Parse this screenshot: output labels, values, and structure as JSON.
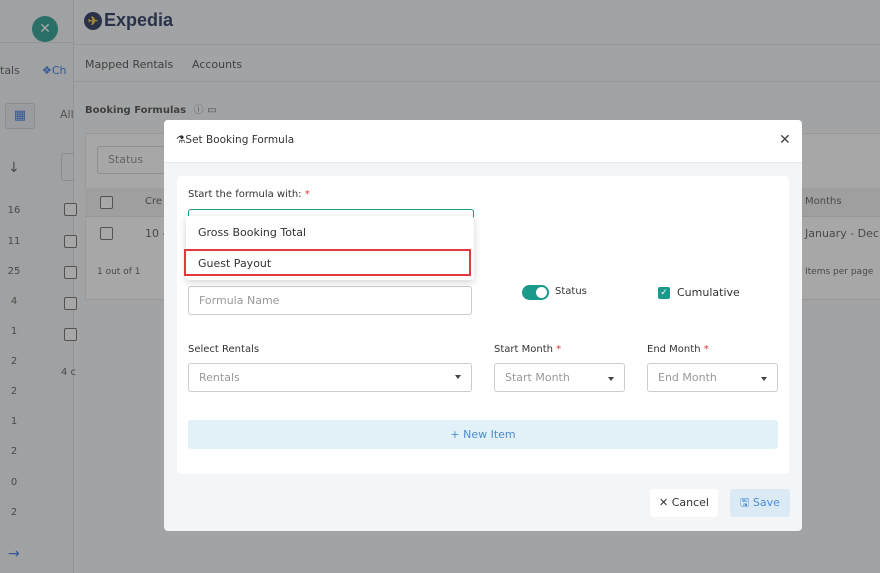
{
  "background": {
    "logo_text": "Expedia",
    "left_tabs_text": "tals",
    "left_tab_active": "Ch",
    "left_all": "All",
    "row_numbers": [
      "16",
      "11",
      "25",
      "4",
      "1",
      "2",
      "2",
      "1",
      "2",
      "0",
      "2"
    ],
    "nav": {
      "mapped_rentals": "Mapped Rentals",
      "accounts": "Accounts"
    },
    "section_title": "Booking Formulas",
    "status_placeholder": "Status",
    "table": {
      "col_created": "Cre",
      "col_months": "Months",
      "row_created": "10 -",
      "row_months": "January - Dec"
    },
    "pagination": "1 out of 1",
    "items_per_page": "Items per page",
    "partial_count": "4 c"
  },
  "modal": {
    "title": "Set Booking Formula",
    "start_label": "Start the formula with:",
    "required_mark": "*",
    "dropdown_options": [
      "Gross Booking Total",
      "Guest Payout"
    ],
    "formula_name_placeholder": "Formula Name",
    "status_label": "Status",
    "cumulative_label": "Cumulative",
    "select_rentals_label": "Select Rentals",
    "rentals_placeholder": "Rentals",
    "start_month_label": "Start Month",
    "start_month_placeholder": "Start Month",
    "end_month_label": "End Month",
    "end_month_placeholder": "End Month",
    "new_item": "+ New Item",
    "cancel": "Cancel",
    "save": "Save"
  },
  "colors": {
    "accent_teal": "#1a9a8a",
    "link_blue": "#4a8cd0",
    "highlight_red": "#e0393e"
  }
}
